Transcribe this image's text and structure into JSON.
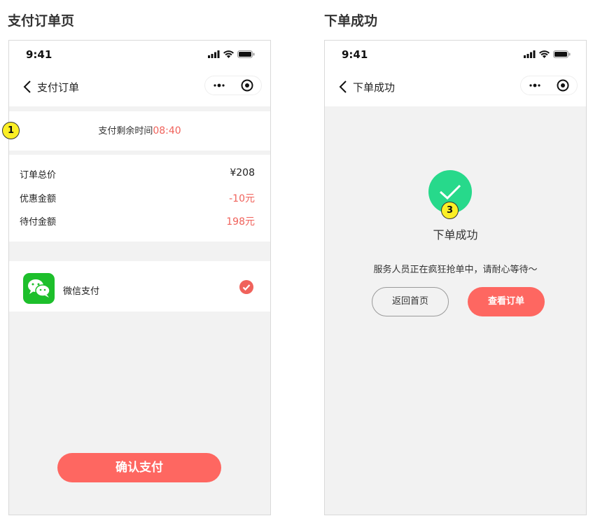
{
  "left": {
    "panel_title": "支付订单页",
    "status_time": "9:41",
    "nav_title": "支付订单",
    "timer_label": "支付剩余时间",
    "timer_value": "08:40",
    "callout": "1",
    "prices": [
      {
        "label": "订单总价",
        "value": "¥208"
      },
      {
        "label": "优惠金额",
        "value": "-10元"
      },
      {
        "label": "待付金额",
        "value": "198元"
      }
    ],
    "payment_method": "微信支付",
    "confirm_label": "确认支付"
  },
  "right": {
    "panel_title": "下单成功",
    "status_time": "9:41",
    "nav_title": "下单成功",
    "callout": "3",
    "success_title": "下单成功",
    "success_desc": "服务人员正在疯狂抢单中，请耐心等待～",
    "home_button": "返回首页",
    "order_button": "查看订单"
  },
  "colors": {
    "accent_red": "#f0625b",
    "button_red": "#fe6761",
    "success_green": "#27d98b",
    "wechat_green": "#1dbf2b",
    "callout_yellow": "#fcef25",
    "background_gray": "#f2f2f2"
  },
  "icons": [
    "back-icon",
    "signal-icon",
    "wifi-icon",
    "battery-icon",
    "more-icon",
    "target-icon",
    "wechat-icon",
    "check-icon",
    "success-check-icon"
  ]
}
